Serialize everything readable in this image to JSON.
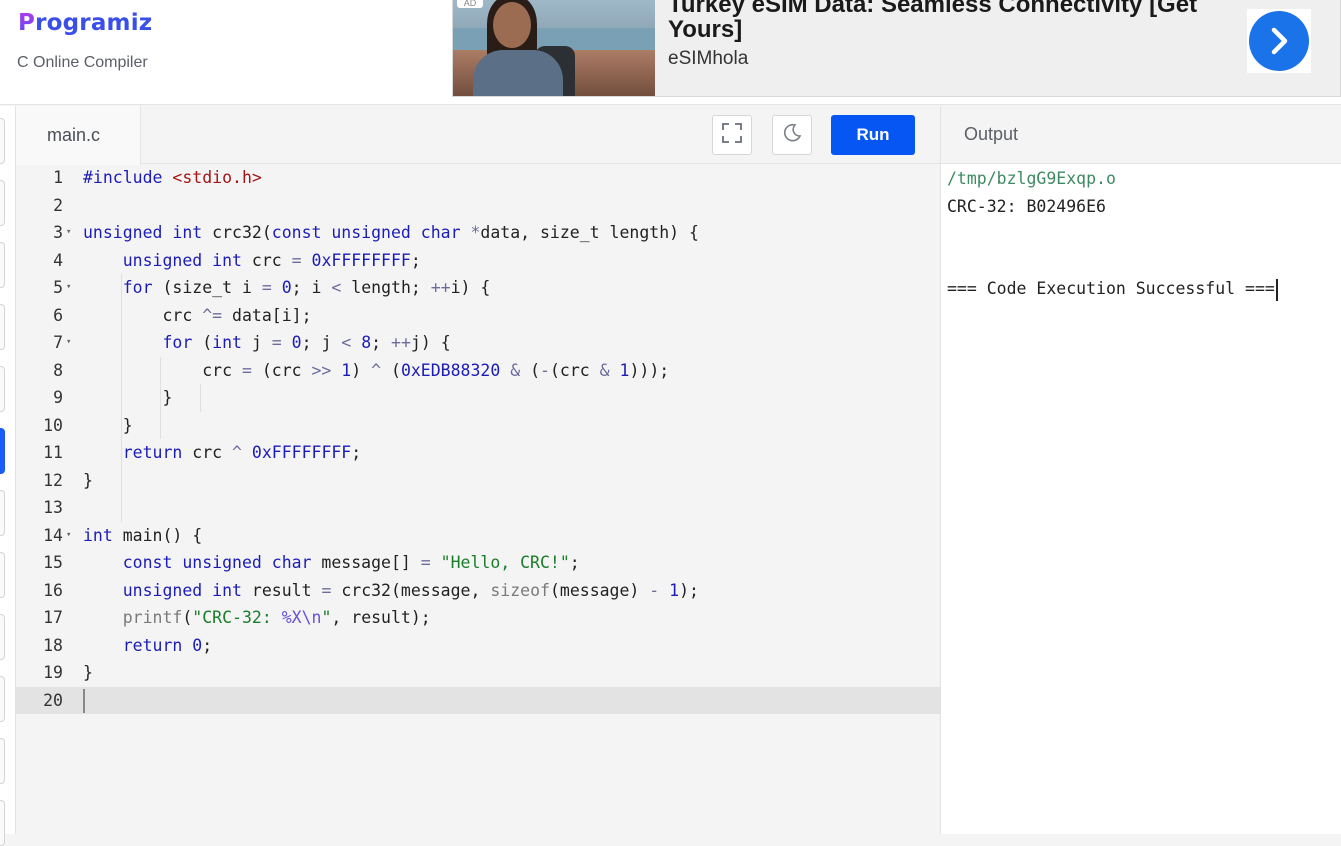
{
  "header": {
    "logo_text": "rogramiz",
    "logo_letter": "P",
    "subtitle": "C Online Compiler"
  },
  "ad": {
    "badge": "AD",
    "title": "Turkey eSIM Data: Seamless Connectivity [Get Yours]",
    "brand": "eSIMhola",
    "arrow_icon": "chevron-right-icon"
  },
  "editor": {
    "file_tab": "main.c",
    "fullscreen_icon": "fullscreen-icon",
    "theme_icon": "moon-icon",
    "run_label": "Run",
    "current_line": 20,
    "lines": [
      {
        "n": "1",
        "fold": "",
        "html_key": "l1"
      },
      {
        "n": "2",
        "fold": "",
        "html_key": "l2"
      },
      {
        "n": "3",
        "fold": "▾",
        "html_key": "l3"
      },
      {
        "n": "4",
        "fold": "",
        "html_key": "l4"
      },
      {
        "n": "5",
        "fold": "▾",
        "html_key": "l5"
      },
      {
        "n": "6",
        "fold": "",
        "html_key": "l6"
      },
      {
        "n": "7",
        "fold": "▾",
        "html_key": "l7"
      },
      {
        "n": "8",
        "fold": "",
        "html_key": "l8"
      },
      {
        "n": "9",
        "fold": "",
        "html_key": "l9"
      },
      {
        "n": "10",
        "fold": "",
        "html_key": "l10"
      },
      {
        "n": "11",
        "fold": "",
        "html_key": "l11"
      },
      {
        "n": "12",
        "fold": "",
        "html_key": "l12"
      },
      {
        "n": "13",
        "fold": "",
        "html_key": "l13"
      },
      {
        "n": "14",
        "fold": "▾",
        "html_key": "l14"
      },
      {
        "n": "15",
        "fold": "",
        "html_key": "l15"
      },
      {
        "n": "16",
        "fold": "",
        "html_key": "l16"
      },
      {
        "n": "17",
        "fold": "",
        "html_key": "l17"
      },
      {
        "n": "18",
        "fold": "",
        "html_key": "l18"
      },
      {
        "n": "19",
        "fold": "",
        "html_key": "l19"
      },
      {
        "n": "20",
        "fold": "",
        "html_key": "l20"
      }
    ],
    "code": [
      [
        [
          "pp",
          "#include "
        ],
        [
          "str",
          "<stdio.h>"
        ]
      ],
      [],
      [
        [
          "ty",
          "unsigned int"
        ],
        [
          "fn",
          " crc32("
        ],
        [
          "kw",
          "const unsigned char"
        ],
        [
          "op",
          " *"
        ],
        [
          "fn",
          "data, size_t length) {"
        ]
      ],
      [
        [
          "fn",
          "    "
        ],
        [
          "ty",
          "unsigned int"
        ],
        [
          "fn",
          " crc "
        ],
        [
          "op",
          "="
        ],
        [
          "num",
          " 0xFFFFFFFF"
        ],
        [
          "fn",
          ";"
        ]
      ],
      [
        [
          "fn",
          "    "
        ],
        [
          "kw",
          "for"
        ],
        [
          "fn",
          " (size_t i "
        ],
        [
          "op",
          "="
        ],
        [
          "num",
          " 0"
        ],
        [
          "fn",
          "; i "
        ],
        [
          "op",
          "<"
        ],
        [
          "fn",
          " length; "
        ],
        [
          "op",
          "++"
        ],
        [
          "fn",
          "i) {"
        ]
      ],
      [
        [
          "fn",
          "        crc "
        ],
        [
          "op",
          "^="
        ],
        [
          "fn",
          " data[i];"
        ]
      ],
      [
        [
          "fn",
          "        "
        ],
        [
          "kw",
          "for"
        ],
        [
          "fn",
          " ("
        ],
        [
          "ty",
          "int"
        ],
        [
          "fn",
          " j "
        ],
        [
          "op",
          "="
        ],
        [
          "num",
          " 0"
        ],
        [
          "fn",
          "; j "
        ],
        [
          "op",
          "<"
        ],
        [
          "num",
          " 8"
        ],
        [
          "fn",
          "; "
        ],
        [
          "op",
          "++"
        ],
        [
          "fn",
          "j) {"
        ]
      ],
      [
        [
          "fn",
          "            crc "
        ],
        [
          "op",
          "="
        ],
        [
          "fn",
          " (crc "
        ],
        [
          "op",
          ">>"
        ],
        [
          "num",
          " 1"
        ],
        [
          "fn",
          ") "
        ],
        [
          "op",
          "^"
        ],
        [
          "fn",
          " ("
        ],
        [
          "num",
          "0xEDB88320"
        ],
        [
          "op",
          " &"
        ],
        [
          "fn",
          " ("
        ],
        [
          "op",
          "-"
        ],
        [
          "fn",
          "(crc "
        ],
        [
          "op",
          "&"
        ],
        [
          "num",
          " 1"
        ],
        [
          "fn",
          ")));"
        ]
      ],
      [
        [
          "fn",
          "        }"
        ]
      ],
      [
        [
          "fn",
          "    }"
        ]
      ],
      [
        [
          "fn",
          "    "
        ],
        [
          "kw",
          "return"
        ],
        [
          "fn",
          " crc "
        ],
        [
          "op",
          "^"
        ],
        [
          "num",
          " 0xFFFFFFFF"
        ],
        [
          "fn",
          ";"
        ]
      ],
      [
        [
          "fn",
          "}"
        ]
      ],
      [],
      [
        [
          "ty",
          "int"
        ],
        [
          "fn",
          " main() {"
        ]
      ],
      [
        [
          "fn",
          "    "
        ],
        [
          "kw",
          "const unsigned char"
        ],
        [
          "fn",
          " message[] "
        ],
        [
          "op",
          "="
        ],
        [
          "fn",
          " "
        ],
        [
          "str2",
          "\"Hello, CRC!\""
        ],
        [
          "fn",
          ";"
        ]
      ],
      [
        [
          "fn",
          "    "
        ],
        [
          "ty",
          "unsigned int"
        ],
        [
          "fn",
          " result "
        ],
        [
          "op",
          "="
        ],
        [
          "fn",
          " crc32(message, "
        ],
        [
          "muted",
          "sizeof"
        ],
        [
          "fn",
          "(message) "
        ],
        [
          "op",
          "-"
        ],
        [
          "num",
          " 1"
        ],
        [
          "fn",
          ");"
        ]
      ],
      [
        [
          "fn",
          "    "
        ],
        [
          "muted",
          "printf"
        ],
        [
          "fn",
          "("
        ],
        [
          "str2",
          "\"CRC-32: "
        ],
        [
          "fmt",
          "%X\\n"
        ],
        [
          "str2",
          "\""
        ],
        [
          "fn",
          ", result);"
        ]
      ],
      [
        [
          "fn",
          "    "
        ],
        [
          "kw",
          "return"
        ],
        [
          "num",
          " 0"
        ],
        [
          "fn",
          ";"
        ]
      ],
      [
        [
          "fn",
          "}"
        ]
      ],
      []
    ]
  },
  "output": {
    "title": "Output",
    "lines": [
      "/tmp/bzlgG9Exqp.o",
      "CRC-32: B02496E6",
      "",
      "",
      "=== Code Execution Successful ==="
    ]
  }
}
